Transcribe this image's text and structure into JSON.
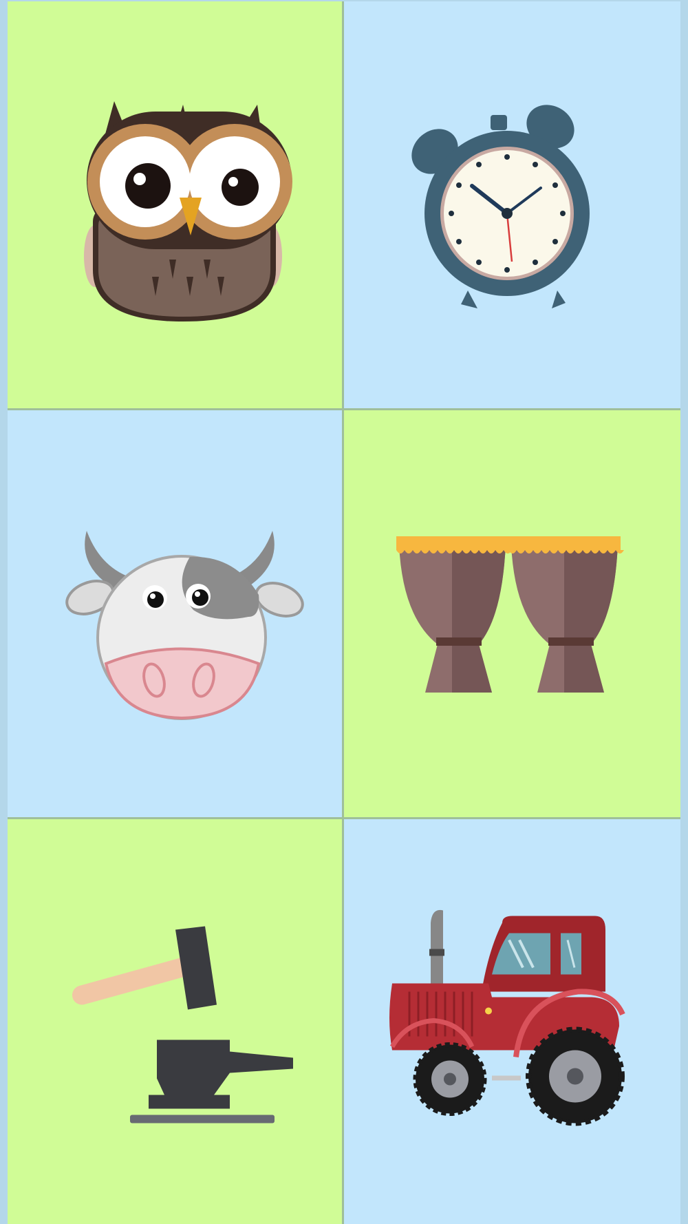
{
  "colors": {
    "green_tile": "#d0fc96",
    "blue_tile": "#c2e6fc",
    "grid_line": "#9fbf9a",
    "frame": "#b4d7ea"
  },
  "tiles": [
    {
      "icon": "owl-icon",
      "bg": "green",
      "label": "owl"
    },
    {
      "icon": "alarm-clock-icon",
      "bg": "blue",
      "label": "alarm clock"
    },
    {
      "icon": "cow-icon",
      "bg": "blue",
      "label": "cow"
    },
    {
      "icon": "bongo-drums-icon",
      "bg": "green",
      "label": "drums"
    },
    {
      "icon": "hammer-anvil-icon",
      "bg": "green",
      "label": "hammer and anvil"
    },
    {
      "icon": "tractor-icon",
      "bg": "blue",
      "label": "tractor"
    }
  ]
}
